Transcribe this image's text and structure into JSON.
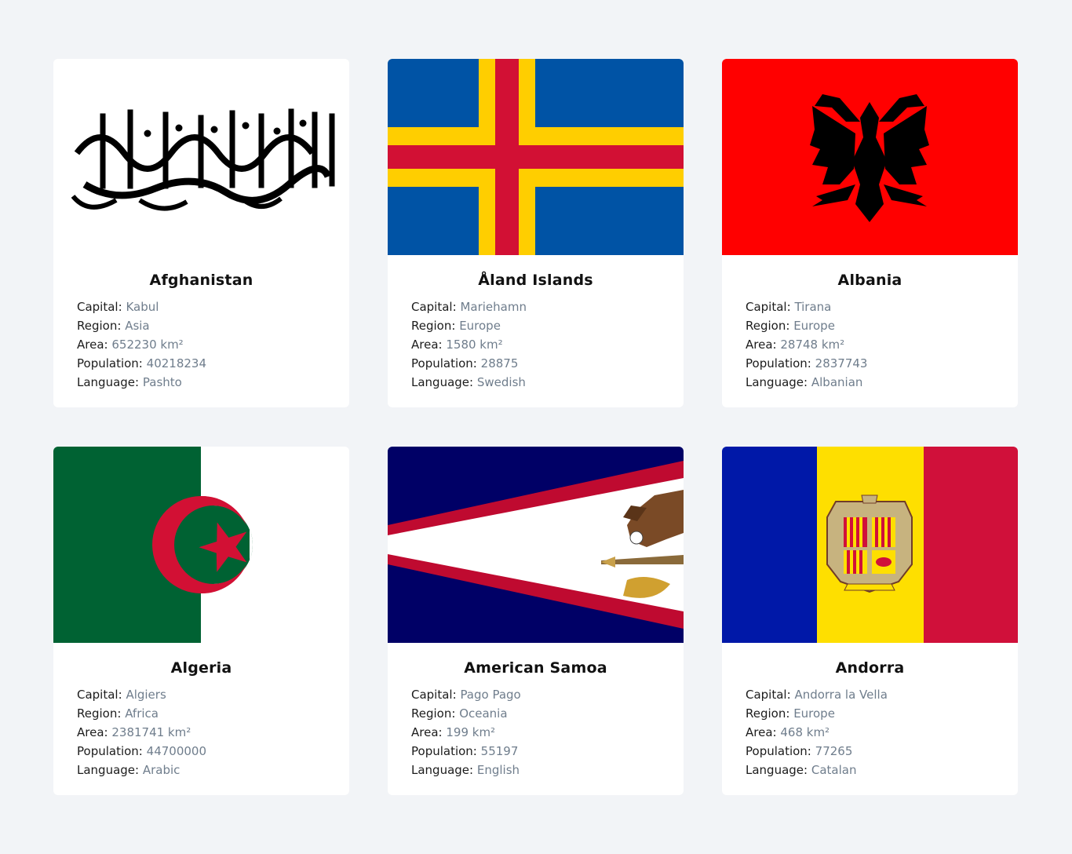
{
  "labels": {
    "capital": "Capital:",
    "region": "Region:",
    "area": "Area:",
    "population": "Population:",
    "language": "Language:"
  },
  "countries": [
    {
      "name": "Afghanistan",
      "capital": "Kabul",
      "region": "Asia",
      "area": "652230 km²",
      "population": "40218234",
      "language": "Pashto",
      "flag": "afghanistan-flag"
    },
    {
      "name": "Åland Islands",
      "capital": "Mariehamn",
      "region": "Europe",
      "area": "1580 km²",
      "population": "28875",
      "language": "Swedish",
      "flag": "aland-flag"
    },
    {
      "name": "Albania",
      "capital": "Tirana",
      "region": "Europe",
      "area": "28748 km²",
      "population": "2837743",
      "language": "Albanian",
      "flag": "albania-flag"
    },
    {
      "name": "Algeria",
      "capital": "Algiers",
      "region": "Africa",
      "area": "2381741 km²",
      "population": "44700000",
      "language": "Arabic",
      "flag": "algeria-flag"
    },
    {
      "name": "American Samoa",
      "capital": "Pago Pago",
      "region": "Oceania",
      "area": "199 km²",
      "population": "55197",
      "language": "English",
      "flag": "american-samoa-flag"
    },
    {
      "name": "Andorra",
      "capital": "Andorra la Vella",
      "region": "Europe",
      "area": "468 km²",
      "population": "77265",
      "language": "Catalan",
      "flag": "andorra-flag"
    }
  ],
  "colors": {
    "background": "#f2f4f7",
    "card": "#ffffff",
    "label": "#1c1c1c",
    "value": "#6f7d8c"
  }
}
